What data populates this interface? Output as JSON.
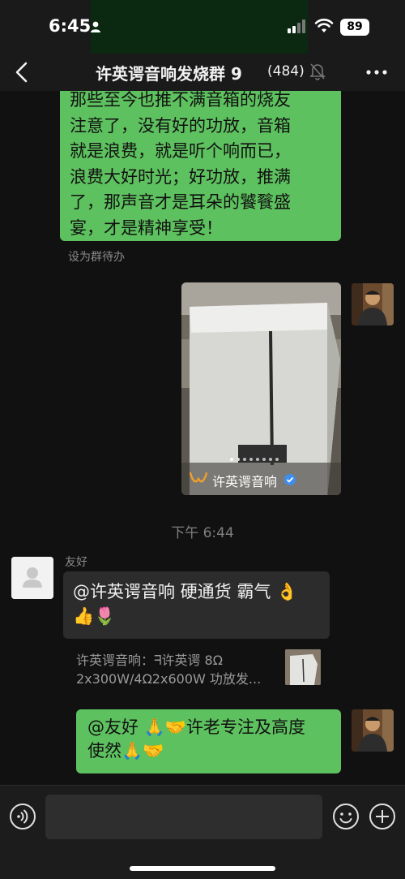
{
  "status_bar": {
    "time": "6:45",
    "battery": "89"
  },
  "nav": {
    "title": "许英谔音响发烧群 9",
    "member_count": "(484)"
  },
  "messages": {
    "m1": {
      "lines": [
        "那些至今也推不满音箱的烧友",
        "注意了，没有好的功放，音箱",
        "就是浪费，就是听个响而已，",
        "浪费大好时光；好功放，推满",
        "了，那声音才是耳朵的饕餮盛",
        "宴，才是精神享受！"
      ]
    },
    "todo_label": "设为群待办",
    "card": {
      "account": "许英谔音响"
    },
    "time_separator": "下午 6:44",
    "m2": {
      "sender": "友好",
      "line1": "@许英谔音响 硬通货 霸气",
      "emoji1": "👌",
      "emoji2": "👍🌷"
    },
    "quote": {
      "line1": "许英谔音响：ᖷ许英谔 8Ω",
      "line2": "2x300W/4Ω2x600W 功放发..."
    },
    "m3": {
      "line1": "@友好 🙏🤝许老专注及高度",
      "line2": "使然🙏🤝"
    }
  },
  "input": {
    "placeholder": ""
  },
  "colors": {
    "bubble_self": "#5ec15f",
    "bubble_other": "#2c2c2c",
    "background": "#111111"
  }
}
